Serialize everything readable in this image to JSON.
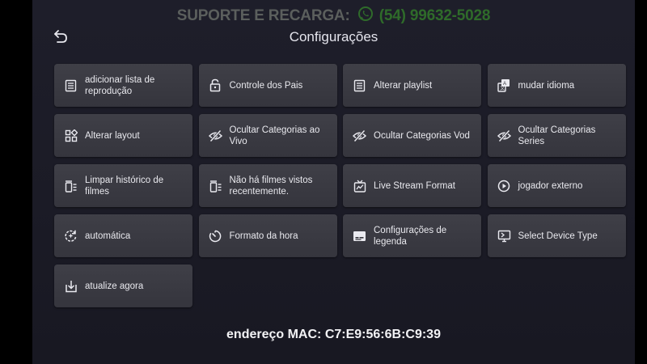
{
  "banner": {
    "support_label": "SUPORTE E RECARGA:",
    "phone": "(54) 99632-5028",
    "icon": "whatsapp-icon",
    "colors": {
      "support": "#5b5f5d",
      "phone": "#2f6b2a"
    }
  },
  "header": {
    "title": "Configurações",
    "back_icon": "back-arrow-icon"
  },
  "settings": [
    {
      "label": "adicionar lista de reprodução",
      "icon": "playlist-icon"
    },
    {
      "label": "Controle dos Pais",
      "icon": "lock-icon"
    },
    {
      "label": "Alterar playlist",
      "icon": "playlist-icon"
    },
    {
      "label": "mudar idioma",
      "icon": "language-icon"
    },
    {
      "label": "Alterar layout",
      "icon": "layout-icon"
    },
    {
      "label": "Ocultar Categorias ao Vivo",
      "icon": "eye-off-icon"
    },
    {
      "label": "Ocultar Categorias Vod",
      "icon": "eye-off-icon"
    },
    {
      "label": "Ocultar Categorias Series",
      "icon": "eye-off-icon"
    },
    {
      "label": "Limpar histórico de filmes",
      "icon": "clear-history-icon"
    },
    {
      "label": "Não há filmes vistos recentemente.",
      "icon": "clear-history-icon"
    },
    {
      "label": "Live Stream Format",
      "icon": "live-tv-icon"
    },
    {
      "label": "jogador externo",
      "icon": "play-circle-icon"
    },
    {
      "label": "automática",
      "icon": "auto-refresh-icon"
    },
    {
      "label": "Formato da hora",
      "icon": "timer-icon"
    },
    {
      "label": "Configurações de legenda",
      "icon": "subtitles-icon"
    },
    {
      "label": "Select Device Type",
      "icon": "device-icon"
    },
    {
      "label": "atualize agora",
      "icon": "download-update-icon"
    }
  ],
  "footer": {
    "mac_label": "endereço MAC: C7:E9:56:6B:C9:39"
  }
}
